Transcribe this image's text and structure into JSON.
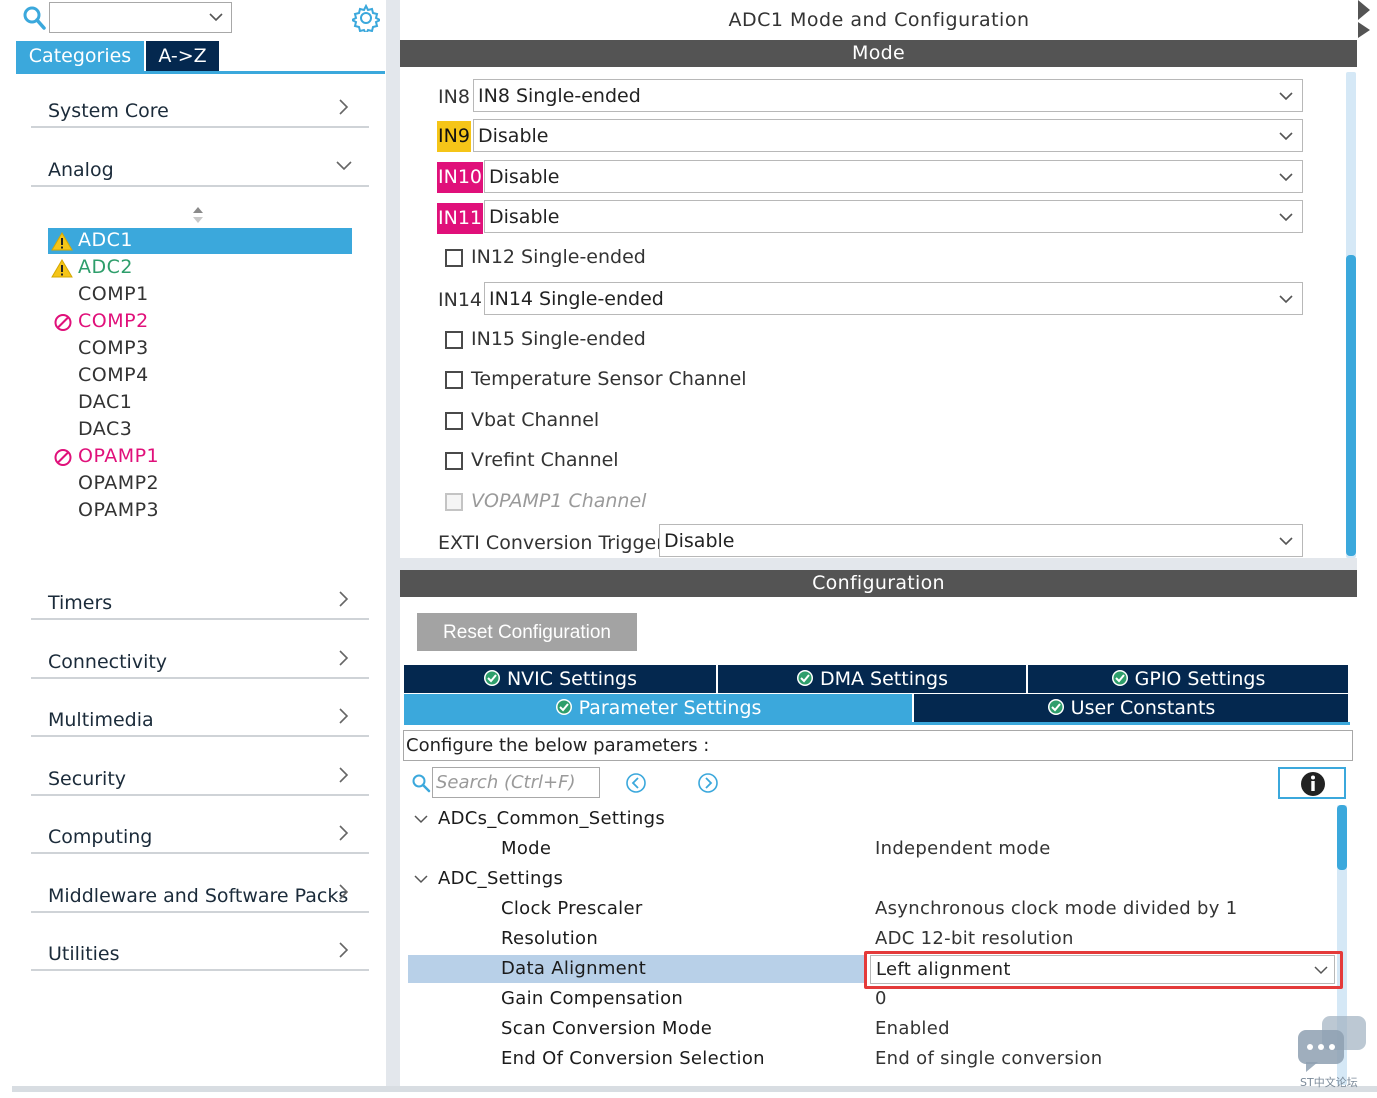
{
  "sidebar": {
    "tabs": {
      "categories": "Categories",
      "az": "A->Z"
    },
    "categories": [
      {
        "label": "System Core",
        "expanded": false
      },
      {
        "label": "Analog",
        "expanded": true
      },
      {
        "label": "Timers",
        "expanded": false
      },
      {
        "label": "Connectivity",
        "expanded": false
      },
      {
        "label": "Multimedia",
        "expanded": false
      },
      {
        "label": "Security",
        "expanded": false
      },
      {
        "label": "Computing",
        "expanded": false
      },
      {
        "label": "Middleware and Software Packs",
        "expanded": false
      },
      {
        "label": "Utilities",
        "expanded": false
      }
    ],
    "analog_items": [
      {
        "label": "ADC1",
        "status": "warning",
        "selected": true
      },
      {
        "label": "ADC2",
        "status": "warning"
      },
      {
        "label": "COMP1",
        "status": "none"
      },
      {
        "label": "COMP2",
        "status": "blocked"
      },
      {
        "label": "COMP3",
        "status": "none"
      },
      {
        "label": "COMP4",
        "status": "none"
      },
      {
        "label": "DAC1",
        "status": "none"
      },
      {
        "label": "DAC3",
        "status": "none"
      },
      {
        "label": "OPAMP1",
        "status": "blocked"
      },
      {
        "label": "OPAMP2",
        "status": "none"
      },
      {
        "label": "OPAMP3",
        "status": "none"
      }
    ]
  },
  "main": {
    "title": "ADC1 Mode and Configuration",
    "mode_header": "Mode",
    "mode": {
      "in8_label": "IN8",
      "in8_value": "IN8 Single-ended",
      "in9_label": "IN9",
      "in9_value": "Disable",
      "in10_label": "IN10",
      "in10_value": "Disable",
      "in11_label": "IN11",
      "in11_value": "Disable",
      "in12_checkbox": "IN12 Single-ended",
      "in14_label": "IN14",
      "in14_value": "IN14 Single-ended",
      "in15_checkbox": "IN15 Single-ended",
      "temp_checkbox": "Temperature Sensor Channel",
      "vbat_checkbox": "Vbat Channel",
      "vrefint_checkbox": "Vrefint Channel",
      "vopamp_checkbox": "VOPAMP1 Channel",
      "exti_label": "EXTI Conversion Trigger",
      "exti_value": "Disable"
    },
    "config_header": "Configuration",
    "reset_button": "Reset Configuration",
    "tabs": {
      "nvic": "NVIC Settings",
      "dma": "DMA Settings",
      "gpio": "GPIO Settings",
      "param": "Parameter Settings",
      "user": "User Constants"
    },
    "hint": "Configure the below parameters :",
    "search_placeholder": "Search (Ctrl+F)",
    "tree": {
      "group1": "ADCs_Common_Settings",
      "mode_name": "Mode",
      "mode_value": "Independent mode",
      "group2": "ADC_Settings",
      "clock_name": "Clock Prescaler",
      "clock_value": "Asynchronous clock mode divided by 1",
      "res_name": "Resolution",
      "res_value": "ADC 12-bit resolution",
      "align_name": "Data Alignment",
      "align_value": "Left alignment",
      "gain_name": "Gain Compensation",
      "gain_value": "0",
      "scan_name": "Scan Conversion Mode",
      "scan_value": "Enabled",
      "eoc_name": "End Of Conversion Selection",
      "eoc_value": "End of single conversion"
    }
  },
  "watermark": "ST中文论坛",
  "colors": {
    "accent": "#3ba8dc",
    "navy": "#04284f",
    "header": "#545454",
    "warning": "#f5c518",
    "blocked": "#e0107a",
    "ok": "#2e9e6b",
    "highlight_outline": "#e43a3a"
  }
}
